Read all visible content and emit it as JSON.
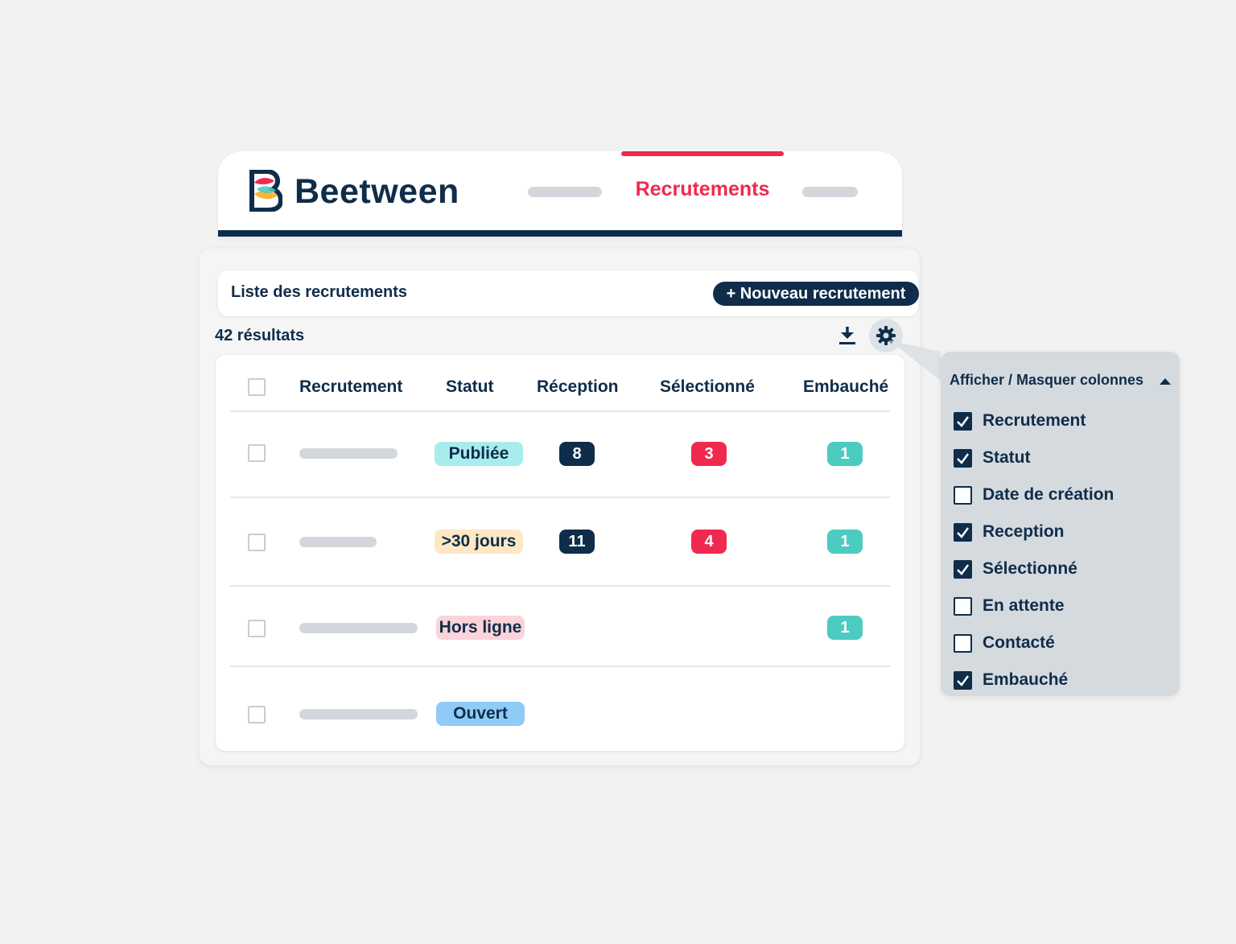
{
  "header": {
    "brand": "Beetween",
    "nav_active": "Recrutements"
  },
  "toolbar": {
    "list_title": "Liste des recrutements",
    "new_button": "+ Nouveau recrutement",
    "results": "42 résultats"
  },
  "table": {
    "columns": [
      "Recrutement",
      "Statut",
      "Réception",
      "Sélectionné",
      "Embauché"
    ],
    "rows": [
      {
        "status": "Publiée",
        "reception": "8",
        "selected": "3",
        "hired": "1"
      },
      {
        "status": ">30 jours",
        "reception": "11",
        "selected": "4",
        "hired": "1"
      },
      {
        "status": "Hors ligne",
        "reception": "",
        "selected": "",
        "hired": "1"
      },
      {
        "status": "Ouvert",
        "reception": "",
        "selected": "",
        "hired": ""
      }
    ]
  },
  "column_panel": {
    "title": "Afficher / Masquer colonnes",
    "options": [
      {
        "label": "Recrutement",
        "checked": true
      },
      {
        "label": "Statut",
        "checked": true
      },
      {
        "label": "Date de création",
        "checked": false
      },
      {
        "label": "Reception",
        "checked": true
      },
      {
        "label": "Sélectionné",
        "checked": true
      },
      {
        "label": "En attente",
        "checked": false
      },
      {
        "label": "Contacté",
        "checked": false
      },
      {
        "label": "Embauché",
        "checked": true
      }
    ]
  },
  "colors": {
    "navy": "#0f2d4a",
    "accent": "#f0294f",
    "teal": "#4ccbc1",
    "status_published": "#a8ecec",
    "status_30days": "#fde7c4",
    "status_offline": "#fbd3da",
    "status_open": "#8fcbf7"
  }
}
